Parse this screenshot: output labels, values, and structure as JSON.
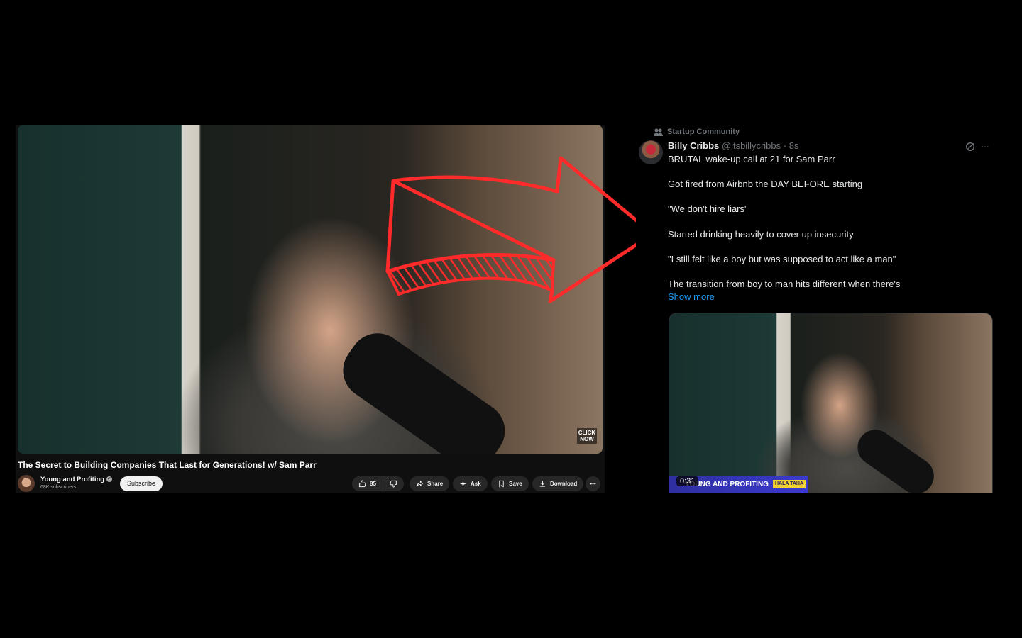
{
  "youtube": {
    "video_badge": "CLICK NOW",
    "title": "The Secret to Building Companies That Last for Generations! w/ Sam Parr",
    "channel_name": "Young and Profiting",
    "verified_icon": "✓",
    "subscribers": "68K subscribers",
    "subscribe_label": "Subscribe",
    "likes": "85",
    "share_label": "Share",
    "ask_label": "Ask",
    "save_label": "Save",
    "download_label": "Download",
    "more_label": "•••"
  },
  "arrow": {
    "color": "#ff2a2a"
  },
  "tweet": {
    "community": "Startup Community",
    "name": "Billy Cribbs",
    "handle": "@itsbillycribbs · 8s",
    "more_label": "···",
    "lines": [
      "BRUTAL wake-up call at 21 for Sam Parr",
      "Got fired from Airbnb the DAY BEFORE starting",
      "\"We don't hire liars\"",
      "Started drinking heavily to cover up insecurity",
      "\"I still felt like a boy but was supposed to act like a man\"",
      "The transition from boy to man hits different when there's"
    ],
    "show_more": "Show more",
    "video_banner": "YOUNG AND PROFITING",
    "video_banner_tag": "HALA TAHA",
    "video_duration": "0:31",
    "link_color": "#1d9bf0"
  }
}
